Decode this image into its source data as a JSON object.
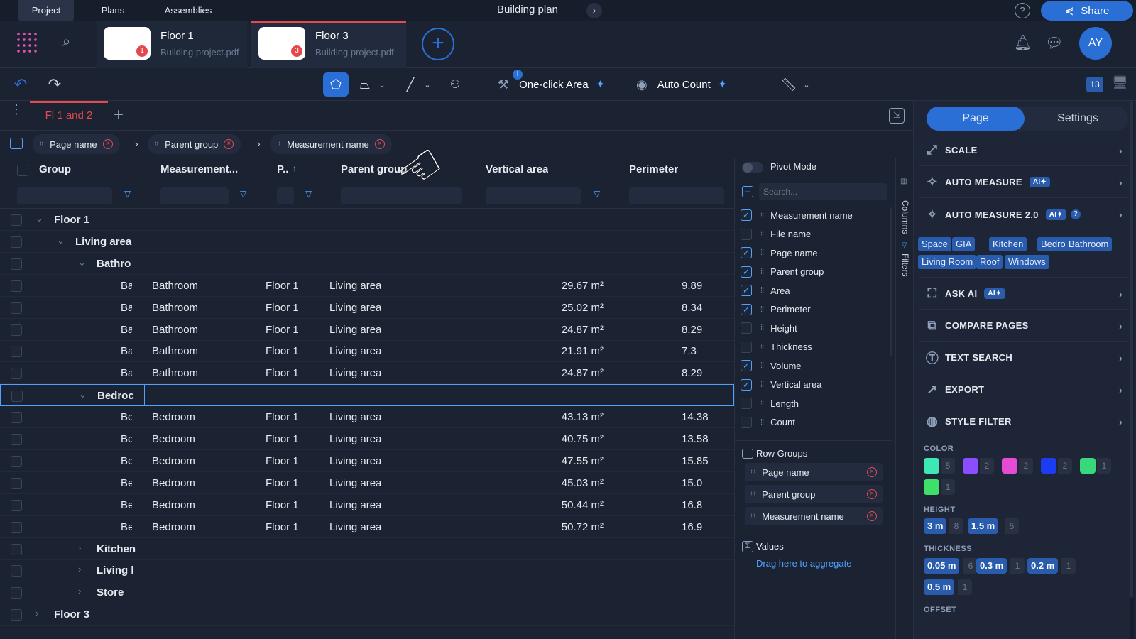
{
  "top_nav": {
    "tabs": [
      "Project",
      "Plans",
      "Assemblies"
    ],
    "title": "Building plan",
    "share": "Share"
  },
  "files": [
    {
      "title": "Floor 1",
      "sub": "Building project.pdf",
      "badge": "1"
    },
    {
      "title": "Floor 3",
      "sub": "Building project.pdf",
      "badge": "3"
    }
  ],
  "user": {
    "initials": "AY"
  },
  "toolbar": {
    "one_click": "One-click Area",
    "auto_count": "Auto Count",
    "count_badge": "13"
  },
  "sheet": {
    "tab": "Fl 1 and 2"
  },
  "group_chips": [
    "Page name",
    "Parent group",
    "Measurement name"
  ],
  "headers": [
    "Group",
    "Measurement...",
    "P..",
    "Parent group",
    "Vertical area",
    "Perimeter"
  ],
  "rows": [
    {
      "lvl": 0,
      "type": "g",
      "label": "Floor 1",
      "open": true
    },
    {
      "lvl": 1,
      "type": "g",
      "label": "Living area",
      "open": true
    },
    {
      "lvl": 2,
      "type": "g",
      "label": "Bathro",
      "open": true
    },
    {
      "type": "d",
      "g": "Ba",
      "m": "Bathroom",
      "p": "Floor 1",
      "pg": "Living area",
      "va": "29.67 m²",
      "pe": "9.89"
    },
    {
      "type": "d",
      "g": "Ba",
      "m": "Bathroom",
      "p": "Floor 1",
      "pg": "Living area",
      "va": "25.02 m²",
      "pe": "8.34"
    },
    {
      "type": "d",
      "g": "Ba",
      "m": "Bathroom",
      "p": "Floor 1",
      "pg": "Living area",
      "va": "24.87 m²",
      "pe": "8.29"
    },
    {
      "type": "d",
      "g": "Ba",
      "m": "Bathroom",
      "p": "Floor 1",
      "pg": "Living area",
      "va": "21.91 m²",
      "pe": "7.3"
    },
    {
      "type": "d",
      "g": "Ba",
      "m": "Bathroom",
      "p": "Floor 1",
      "pg": "Living area",
      "va": "24.87 m²",
      "pe": "8.29"
    },
    {
      "lvl": 2,
      "type": "g",
      "label": "Bedroc",
      "open": true,
      "sel": true
    },
    {
      "type": "d",
      "g": "Be",
      "m": "Bedroom",
      "p": "Floor 1",
      "pg": "Living area",
      "va": "43.13 m²",
      "pe": "14.38"
    },
    {
      "type": "d",
      "g": "Be",
      "m": "Bedroom",
      "p": "Floor 1",
      "pg": "Living area",
      "va": "40.75 m²",
      "pe": "13.58"
    },
    {
      "type": "d",
      "g": "Be",
      "m": "Bedroom",
      "p": "Floor 1",
      "pg": "Living area",
      "va": "47.55 m²",
      "pe": "15.85"
    },
    {
      "type": "d",
      "g": "Be",
      "m": "Bedroom",
      "p": "Floor 1",
      "pg": "Living area",
      "va": "45.03 m²",
      "pe": "15.0"
    },
    {
      "type": "d",
      "g": "Be",
      "m": "Bedroom",
      "p": "Floor 1",
      "pg": "Living area",
      "va": "50.44 m²",
      "pe": "16.8"
    },
    {
      "type": "d",
      "g": "Be",
      "m": "Bedroom",
      "p": "Floor 1",
      "pg": "Living area",
      "va": "50.72 m²",
      "pe": "16.9"
    },
    {
      "lvl": 2,
      "type": "g",
      "label": "Kitchen",
      "open": false
    },
    {
      "lvl": 2,
      "type": "g",
      "label": "Living l",
      "open": false
    },
    {
      "lvl": 2,
      "type": "g",
      "label": "Store",
      "open": false
    },
    {
      "lvl": 0,
      "type": "g",
      "label": "Floor 3",
      "open": false
    }
  ],
  "pivot": {
    "mode_label": "Pivot Mode",
    "search_placeholder": "Search...",
    "columns": [
      {
        "label": "Measurement name",
        "on": true
      },
      {
        "label": "File name",
        "on": false
      },
      {
        "label": "Page name",
        "on": true
      },
      {
        "label": "Parent group",
        "on": true
      },
      {
        "label": "Area",
        "on": true
      },
      {
        "label": "Perimeter",
        "on": true
      },
      {
        "label": "Height",
        "on": false
      },
      {
        "label": "Thickness",
        "on": false
      },
      {
        "label": "Volume",
        "on": true
      },
      {
        "label": "Vertical area",
        "on": true
      },
      {
        "label": "Length",
        "on": false
      },
      {
        "label": "Count",
        "on": false
      }
    ],
    "row_groups_label": "Row Groups",
    "row_groups": [
      "Page name",
      "Parent group",
      "Measurement name"
    ],
    "values_label": "Values",
    "values_hint": "Drag here to aggregate",
    "side_tabs": [
      "Columns",
      "Filters"
    ]
  },
  "sidebar": {
    "tabs": [
      "Page",
      "Settings"
    ],
    "items": [
      "SCALE",
      "AUTO MEASURE",
      "AUTO MEASURE 2.0",
      "ASK AI",
      "COMPARE PAGES",
      "TEXT SEARCH",
      "EXPORT",
      "STYLE FILTER"
    ],
    "ai_badge": "AI",
    "tags": [
      "Space",
      "GIA",
      "Kitchen",
      "Bedroom",
      "Bathroom",
      "Living Room",
      "Roof",
      "Windows"
    ],
    "color_label": "COLOR",
    "colors": [
      {
        "c": "#3ee8b5",
        "n": "5"
      },
      {
        "c": "#8a4dff",
        "n": "2"
      },
      {
        "c": "#e64bd6",
        "n": "2"
      },
      {
        "c": "#1b3cf0",
        "n": "2"
      },
      {
        "c": "#38d97a",
        "n": "1"
      },
      {
        "c": "#3fe06a",
        "n": "1"
      }
    ],
    "height_label": "HEIGHT",
    "heights": [
      {
        "v": "3 m",
        "n": "8"
      },
      {
        "v": "1.5 m",
        "n": "5"
      }
    ],
    "thickness_label": "THICKNESS",
    "thicknesses": [
      {
        "v": "0.05 m",
        "n": "6"
      },
      {
        "v": "0.3 m",
        "n": "1"
      },
      {
        "v": "0.2 m",
        "n": "1"
      },
      {
        "v": "0.5 m",
        "n": "1"
      }
    ],
    "offset_label": "OFFSET"
  }
}
